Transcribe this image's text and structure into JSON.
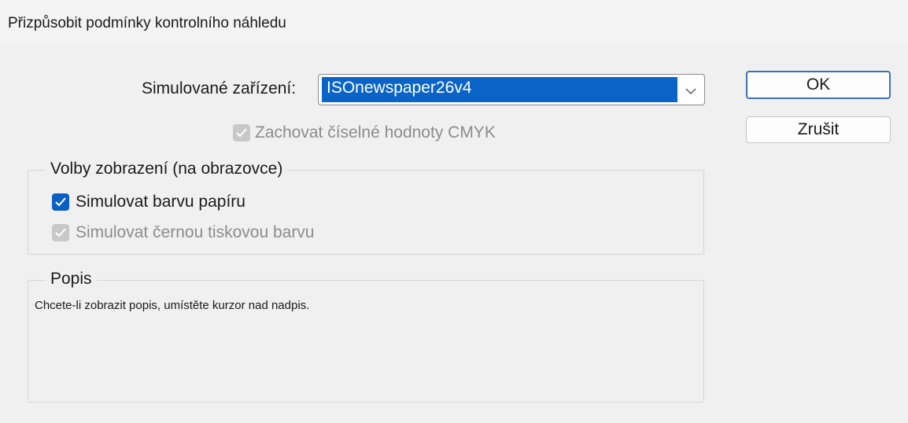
{
  "window": {
    "title": "Přizpůsobit podmínky kontrolního náhledu"
  },
  "device": {
    "label": "Simulované zařízení:",
    "value": "ISOnewspaper26v4"
  },
  "preserve_cmyk": {
    "label": "Zachovat číselné hodnoty CMYK",
    "checked": true,
    "enabled": false
  },
  "buttons": {
    "ok": "OK",
    "cancel": "Zrušit"
  },
  "display_options": {
    "legend": "Volby zobrazení (na obrazovce)",
    "paper": {
      "label": "Simulovat barvu papíru",
      "checked": true,
      "enabled": true
    },
    "black": {
      "label": "Simulovat černou tiskovou barvu",
      "checked": true,
      "enabled": false
    }
  },
  "description": {
    "legend": "Popis",
    "text": "Chcete-li zobrazit popis, umístěte kurzor nad nadpis."
  },
  "colors": {
    "accent": "#0a5fc4",
    "selection": "#0a64c8",
    "default_button_border": "#3c72b6",
    "disabled_check": "#c8c8c8"
  },
  "icons": {
    "combo_arrow": "chevron-down-icon",
    "check": "checkmark-icon"
  }
}
